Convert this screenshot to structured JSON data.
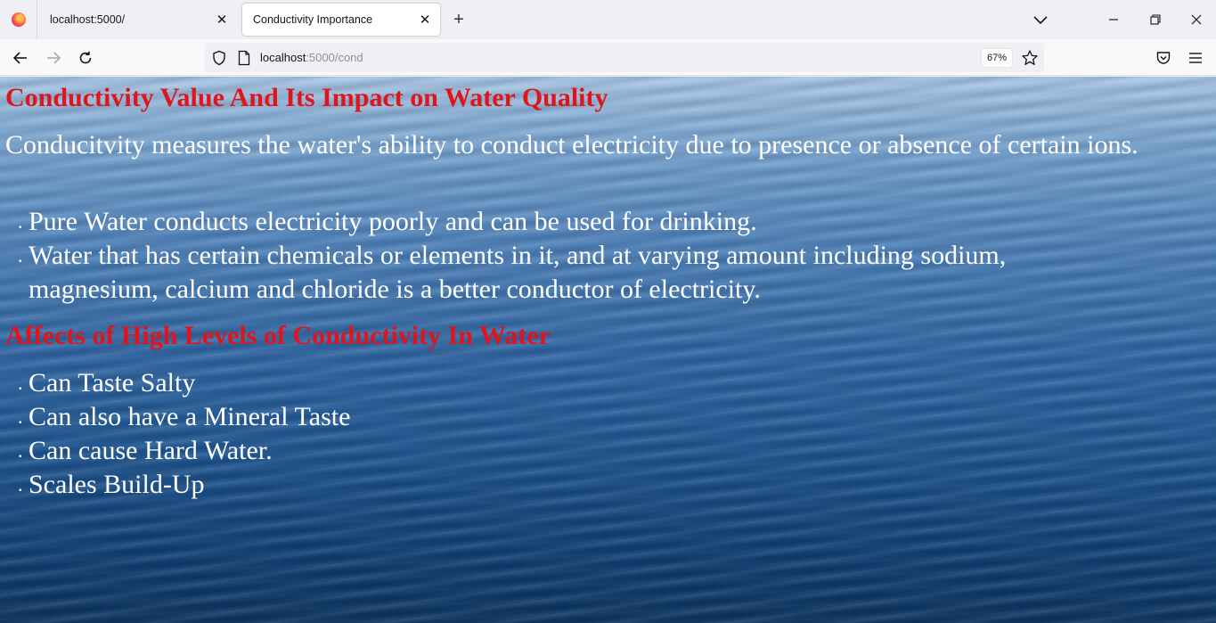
{
  "browser": {
    "tabs": [
      {
        "title": "localhost:5000/",
        "active": false
      },
      {
        "title": "Conductivity Importance",
        "active": true
      }
    ],
    "url_host": "localhost",
    "url_path": ":5000/cond",
    "zoom": "67%"
  },
  "page": {
    "heading": "Conductivity Value And Its Impact on Water Quality",
    "intro": "Conducitvity measures the water's ability to conduct electricity due to presence or absence of certain ions.",
    "list1": [
      "Pure Water conducts electricity poorly and can be used for drinking.",
      "Water that has certain chemicals or elements in it, and at varying amount including sodium, magnesium, calcium and chloride is a better conductor of electricity."
    ],
    "subheading": "Affects of High Levels of Conductivity In Water",
    "list2": [
      "Can Taste Salty",
      "Can also have a Mineral Taste",
      "Can cause Hard Water.",
      "Scales Build-Up"
    ]
  },
  "colors": {
    "heading": "#e0141c",
    "body_text": "#ffffff"
  }
}
